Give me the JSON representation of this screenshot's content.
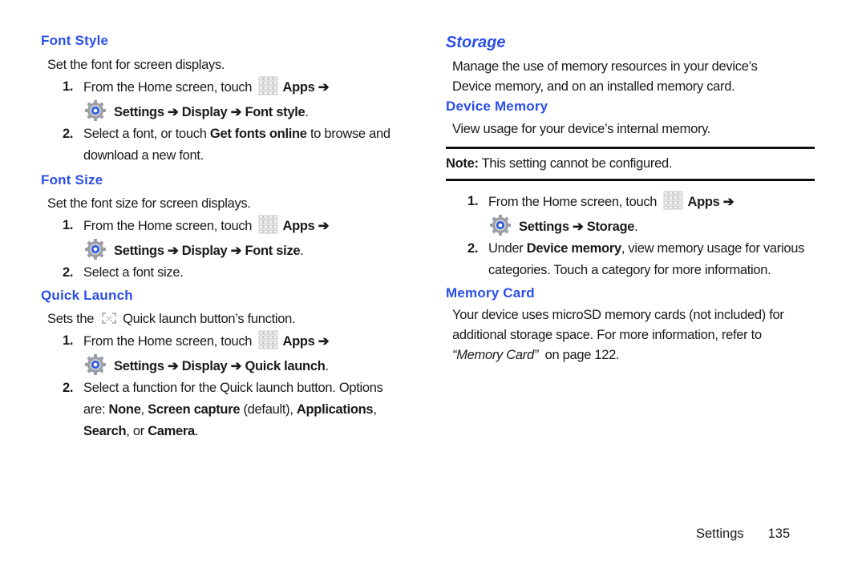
{
  "left": {
    "font_style": {
      "heading": "Font Style",
      "intro": "Set the font for screen displays.",
      "step1": {
        "num": "1.",
        "pre": "From the Home screen, touch",
        "apps": "Apps ➔",
        "path": "Settings ➔ Display ➔ Font style",
        "end": "."
      },
      "step2": {
        "num": "2.",
        "pre": "Select a font, or touch ",
        "bold": "Get fonts online",
        "post": " to browse and",
        "line2": "download a new font."
      }
    },
    "font_size": {
      "heading": "Font Size",
      "intro": "Set the font size for screen displays.",
      "step1": {
        "num": "1.",
        "pre": "From the Home screen, touch",
        "apps": "Apps ➔",
        "path": "Settings ➔ Display ➔ Font size",
        "end": "."
      },
      "step2": {
        "num": "2.",
        "text": "Select a font size."
      }
    },
    "quick_launch": {
      "heading": "Quick Launch",
      "intro_pre": "Sets the",
      "intro_post": "Quick launch button’s function.",
      "step1": {
        "num": "1.",
        "pre": "From the Home screen, touch",
        "apps": "Apps ➔",
        "path": "Settings ➔ Display ➔ Quick launch",
        "end": "."
      },
      "step2": {
        "num": "2.",
        "line1": "Select a function for the Quick launch button. Options",
        "are": "are: ",
        "opt1": "None",
        "c1": ", ",
        "opt2": "Screen capture",
        "c2": " (default), ",
        "opt3": "Applications",
        "c3": ",",
        "opt4": "Search",
        "c4": ", or ",
        "opt5": "Camera",
        "c5": "."
      }
    }
  },
  "right": {
    "storage": {
      "heading": "Storage",
      "intro_line1": "Manage the use of memory resources in your device’s",
      "intro_line2": "Device memory, and on an installed memory card."
    },
    "device_memory": {
      "heading": "Device Memory",
      "intro": "View usage for your device’s internal memory.",
      "note_label": "Note:",
      "note_text": " This setting cannot be configured.",
      "step1": {
        "num": "1.",
        "pre": "From the Home screen, touch",
        "apps": "Apps ➔",
        "path": "Settings ➔ Storage",
        "end": "."
      },
      "step2": {
        "num": "2.",
        "pre": "Under ",
        "bold": "Device memory",
        "post": ", view memory usage for various",
        "line2": "categories. Touch a category for more information."
      }
    },
    "memory_card": {
      "heading": "Memory Card",
      "line1": "Your device uses microSD memory cards (not included) for",
      "line2": "additional storage space. For more information, refer to",
      "ref": "“Memory Card”",
      "ref_post": "  on page 122."
    }
  },
  "footer": {
    "section": "Settings",
    "page": "135"
  },
  "colors": {
    "heading": "#2a4fe8",
    "text": "#1a1a1a",
    "rule": "#111111"
  },
  "icons": {
    "apps": "apps-grid-icon",
    "settings": "settings-gear-icon",
    "quick_launch": "quick-launch-icon"
  }
}
